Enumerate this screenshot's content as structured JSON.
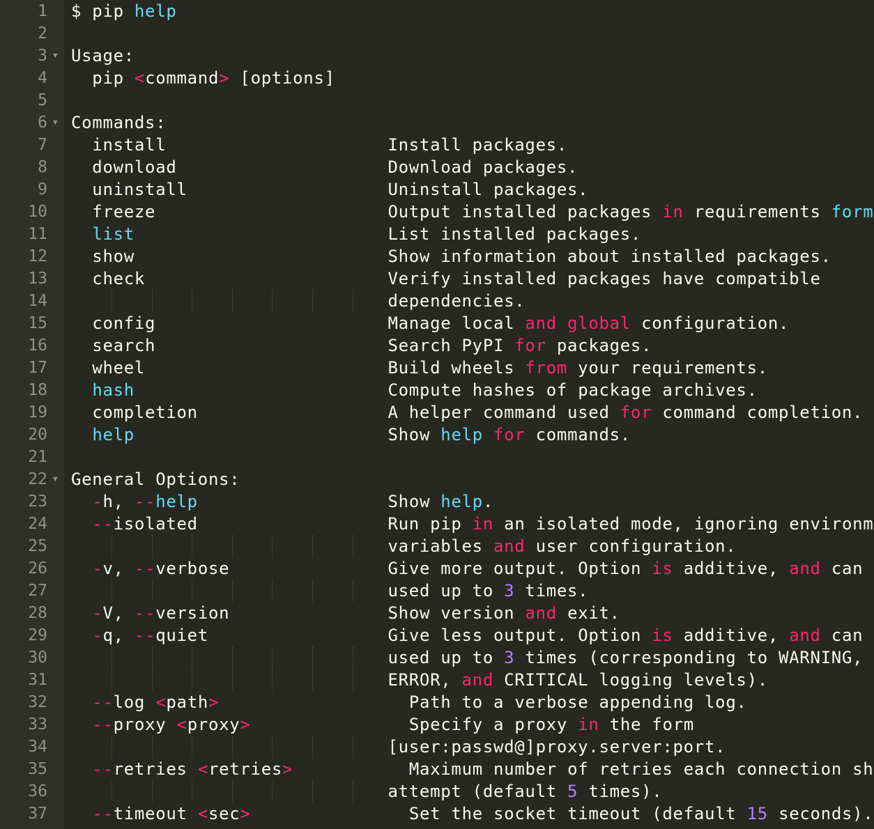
{
  "colors": {
    "background": "#272822",
    "gutter": "#2f3129",
    "line_number": "#8f908a",
    "text": "#f8f8f2",
    "keyword": "#f92672",
    "builtin": "#66d9ef",
    "number": "#ae81ff"
  },
  "icons": {
    "fold": "fold-arrow-icon"
  },
  "lines": [
    {
      "n": "1",
      "spans": [
        [
          "$ pip ",
          "t"
        ],
        [
          "help",
          "fn"
        ]
      ]
    },
    {
      "n": "2",
      "spans": []
    },
    {
      "n": "3",
      "fold": true,
      "spans": [
        [
          "Usage:",
          "t"
        ]
      ]
    },
    {
      "n": "4",
      "spans": [
        [
          "  pip ",
          "t"
        ],
        [
          "<",
          "kw"
        ],
        [
          "command",
          "t"
        ],
        [
          ">",
          "kw"
        ],
        [
          " [options]",
          "t"
        ]
      ]
    },
    {
      "n": "5",
      "spans": []
    },
    {
      "n": "6",
      "fold": true,
      "spans": [
        [
          "Commands:",
          "t"
        ]
      ]
    },
    {
      "n": "7",
      "spans": [
        [
          "  install                     Install packages.",
          "t"
        ]
      ]
    },
    {
      "n": "8",
      "spans": [
        [
          "  download                    Download packages.",
          "t"
        ]
      ]
    },
    {
      "n": "9",
      "spans": [
        [
          "  uninstall                   Uninstall packages.",
          "t"
        ]
      ]
    },
    {
      "n": "10",
      "spans": [
        [
          "  freeze                      Output installed packages ",
          "t"
        ],
        [
          "in",
          "kw"
        ],
        [
          " requirements ",
          "t"
        ],
        [
          "format",
          "fn"
        ],
        [
          ".",
          "t"
        ]
      ]
    },
    {
      "n": "11",
      "spans": [
        [
          "  ",
          "t"
        ],
        [
          "list",
          "fn"
        ],
        [
          "                        List installed packages.",
          "t"
        ]
      ]
    },
    {
      "n": "12",
      "spans": [
        [
          "  show                        Show information about installed packages.",
          "t"
        ]
      ]
    },
    {
      "n": "13",
      "spans": [
        [
          "  check                       Verify installed packages have compatible",
          "t"
        ]
      ]
    },
    {
      "n": "14",
      "guides": true,
      "spans": [
        [
          "                              dependencies.",
          "t"
        ]
      ]
    },
    {
      "n": "15",
      "spans": [
        [
          "  config                      Manage local ",
          "t"
        ],
        [
          "and",
          "kw"
        ],
        [
          " ",
          "t"
        ],
        [
          "global",
          "kw"
        ],
        [
          " configuration.",
          "t"
        ]
      ]
    },
    {
      "n": "16",
      "spans": [
        [
          "  search                      Search PyPI ",
          "t"
        ],
        [
          "for",
          "kw"
        ],
        [
          " packages.",
          "t"
        ]
      ]
    },
    {
      "n": "17",
      "spans": [
        [
          "  wheel                       Build wheels ",
          "t"
        ],
        [
          "from",
          "kw"
        ],
        [
          " your requirements.",
          "t"
        ]
      ]
    },
    {
      "n": "18",
      "spans": [
        [
          "  ",
          "t"
        ],
        [
          "hash",
          "fn"
        ],
        [
          "                        Compute hashes of package archives.",
          "t"
        ]
      ]
    },
    {
      "n": "19",
      "spans": [
        [
          "  completion                  A helper command used ",
          "t"
        ],
        [
          "for",
          "kw"
        ],
        [
          " command completion.",
          "t"
        ]
      ]
    },
    {
      "n": "20",
      "spans": [
        [
          "  ",
          "t"
        ],
        [
          "help",
          "fn"
        ],
        [
          "                        Show ",
          "t"
        ],
        [
          "help",
          "fn"
        ],
        [
          " ",
          "t"
        ],
        [
          "for",
          "kw"
        ],
        [
          " commands.",
          "t"
        ]
      ]
    },
    {
      "n": "21",
      "spans": []
    },
    {
      "n": "22",
      "fold": true,
      "spans": [
        [
          "General Options:",
          "t"
        ]
      ]
    },
    {
      "n": "23",
      "spans": [
        [
          "  ",
          "t"
        ],
        [
          "-",
          "kw"
        ],
        [
          "h, ",
          "t"
        ],
        [
          "--",
          "kw"
        ],
        [
          "help",
          "fn"
        ],
        [
          "                  Show ",
          "t"
        ],
        [
          "help",
          "fn"
        ],
        [
          ".",
          "t"
        ]
      ]
    },
    {
      "n": "24",
      "spans": [
        [
          "  ",
          "t"
        ],
        [
          "--",
          "kw"
        ],
        [
          "isolated                  Run pip ",
          "t"
        ],
        [
          "in",
          "kw"
        ],
        [
          " an isolated mode, ignoring environment",
          "t"
        ]
      ]
    },
    {
      "n": "25",
      "guides": true,
      "spans": [
        [
          "                              variables ",
          "t"
        ],
        [
          "and",
          "kw"
        ],
        [
          " user configuration.",
          "t"
        ]
      ]
    },
    {
      "n": "26",
      "spans": [
        [
          "  ",
          "t"
        ],
        [
          "-",
          "kw"
        ],
        [
          "v, ",
          "t"
        ],
        [
          "--",
          "kw"
        ],
        [
          "verbose               Give more output. Option ",
          "t"
        ],
        [
          "is",
          "kw"
        ],
        [
          " additive, ",
          "t"
        ],
        [
          "and",
          "kw"
        ],
        [
          " can be",
          "t"
        ]
      ]
    },
    {
      "n": "27",
      "guides": true,
      "spans": [
        [
          "                              used up to ",
          "t"
        ],
        [
          "3",
          "num"
        ],
        [
          " times.",
          "t"
        ]
      ]
    },
    {
      "n": "28",
      "spans": [
        [
          "  ",
          "t"
        ],
        [
          "-",
          "kw"
        ],
        [
          "V, ",
          "t"
        ],
        [
          "--",
          "kw"
        ],
        [
          "version               Show version ",
          "t"
        ],
        [
          "and",
          "kw"
        ],
        [
          " exit.",
          "t"
        ]
      ]
    },
    {
      "n": "29",
      "spans": [
        [
          "  ",
          "t"
        ],
        [
          "-",
          "kw"
        ],
        [
          "q, ",
          "t"
        ],
        [
          "--",
          "kw"
        ],
        [
          "quiet                 Give less output. Option ",
          "t"
        ],
        [
          "is",
          "kw"
        ],
        [
          " additive, ",
          "t"
        ],
        [
          "and",
          "kw"
        ],
        [
          " can be",
          "t"
        ]
      ]
    },
    {
      "n": "30",
      "guides": true,
      "spans": [
        [
          "                              used up to ",
          "t"
        ],
        [
          "3",
          "num"
        ],
        [
          " times (corresponding to WARNING,",
          "t"
        ]
      ]
    },
    {
      "n": "31",
      "guides": true,
      "spans": [
        [
          "                              ERROR, ",
          "t"
        ],
        [
          "and",
          "kw"
        ],
        [
          " CRITICAL logging levels).",
          "t"
        ]
      ]
    },
    {
      "n": "32",
      "spans": [
        [
          "  ",
          "t"
        ],
        [
          "--",
          "kw"
        ],
        [
          "log ",
          "t"
        ],
        [
          "<",
          "kw"
        ],
        [
          "path",
          "t"
        ],
        [
          ">",
          "kw"
        ],
        [
          "                  Path to a verbose appending log.",
          "t"
        ]
      ]
    },
    {
      "n": "33",
      "spans": [
        [
          "  ",
          "t"
        ],
        [
          "--",
          "kw"
        ],
        [
          "proxy ",
          "t"
        ],
        [
          "<",
          "kw"
        ],
        [
          "proxy",
          "t"
        ],
        [
          ">",
          "kw"
        ],
        [
          "               Specify a proxy ",
          "t"
        ],
        [
          "in",
          "kw"
        ],
        [
          " the form",
          "t"
        ]
      ]
    },
    {
      "n": "34",
      "guides": true,
      "spans": [
        [
          "                              [user:passwd@]proxy.server:port.",
          "t"
        ]
      ]
    },
    {
      "n": "35",
      "spans": [
        [
          "  ",
          "t"
        ],
        [
          "--",
          "kw"
        ],
        [
          "retries ",
          "t"
        ],
        [
          "<",
          "kw"
        ],
        [
          "retries",
          "t"
        ],
        [
          ">",
          "kw"
        ],
        [
          "           Maximum number of retries each connection should",
          "t"
        ]
      ]
    },
    {
      "n": "36",
      "guides": true,
      "spans": [
        [
          "                              attempt (default ",
          "t"
        ],
        [
          "5",
          "num"
        ],
        [
          " times).",
          "t"
        ]
      ]
    },
    {
      "n": "37",
      "spans": [
        [
          "  ",
          "t"
        ],
        [
          "--",
          "kw"
        ],
        [
          "timeout ",
          "t"
        ],
        [
          "<",
          "kw"
        ],
        [
          "sec",
          "t"
        ],
        [
          ">",
          "kw"
        ],
        [
          "               Set the socket timeout (default ",
          "t"
        ],
        [
          "15",
          "num"
        ],
        [
          " seconds).",
          "t"
        ]
      ]
    }
  ]
}
